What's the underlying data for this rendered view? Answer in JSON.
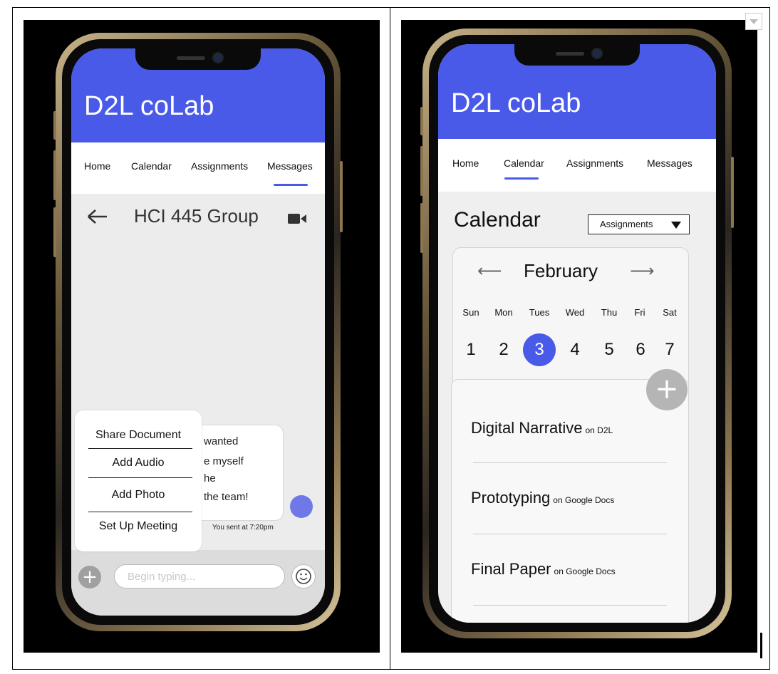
{
  "colors": {
    "accent": "#4a5ae8",
    "sent_dot": "#6f78e6",
    "fab": "#b5b5b5"
  },
  "left_screen": {
    "app_title": "D2L coLab",
    "nav": [
      "Home",
      "Calendar",
      "Assignments",
      "Messages"
    ],
    "active_tab": "Messages",
    "chat": {
      "title": "HCI 445 Group",
      "back_icon": "back-arrow-icon",
      "call_icon": "video-camera-icon",
      "message_lines": [
        "wanted",
        "e myself",
        "he",
        "the team!"
      ],
      "sent_time": "You sent at 7:20pm"
    },
    "attach_menu": [
      "Share Document",
      "Add Audio",
      "Add Photo",
      "Set Up Meeting"
    ],
    "input": {
      "placeholder": "Begin typing...",
      "add_icon": "plus-icon",
      "emoji_icon": "smiley-icon"
    }
  },
  "right_screen": {
    "app_title": "D2L coLab",
    "nav": [
      "Home",
      "Calendar",
      "Assignments",
      "Messages"
    ],
    "active_tab": "Calendar",
    "heading": "Calendar",
    "filter": "Assignments",
    "month": "February",
    "weekdays": [
      "Sun",
      "Mon",
      "Tues",
      "Wed",
      "Thu",
      "Fri",
      "Sat"
    ],
    "days": [
      "1",
      "2",
      "3",
      "4",
      "5",
      "6",
      "7"
    ],
    "selected_day": "3",
    "tasks": [
      {
        "name": "Digital Narrative",
        "source": "on D2L"
      },
      {
        "name": "Prototyping",
        "source": "on Google Docs"
      },
      {
        "name": "Final Paper",
        "source": "on Google Docs"
      }
    ]
  }
}
